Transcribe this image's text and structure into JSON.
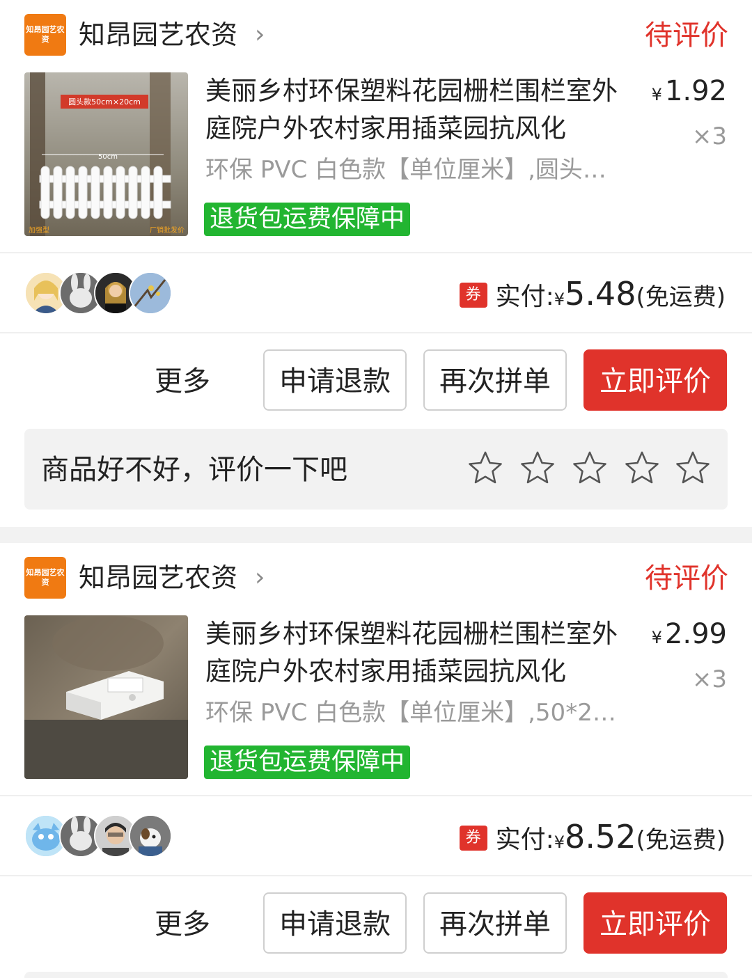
{
  "orders": [
    {
      "store": {
        "logo_text": "知昂园艺农资",
        "name": "知昂园艺农资",
        "chevron": "›"
      },
      "status": "待评价",
      "product": {
        "title": "美丽乡村环保塑料花园栅栏围栏室外庭院户外农村家用插菜园抗风化",
        "spec": "环保 PVC 白色款【单位厘米】,圆头…",
        "badge": "退货包运费保障中",
        "currency": "¥",
        "price": "1.92",
        "qty": "×3",
        "image_labels": {
          "top": "圆头款50cm×20cm",
          "width": "50cm",
          "bottom_left": "加强型",
          "bottom_right": "厂销批发价"
        }
      },
      "payment": {
        "coupon": "券",
        "label": "实付:",
        "currency": "¥",
        "amount": "5.48",
        "shipping": "(免运费)"
      },
      "actions": {
        "more": "更多",
        "refund": "申请退款",
        "reorder": "再次拼单",
        "review": "立即评价"
      },
      "review_prompt": "商品好不好，评价一下吧",
      "stars": 5
    },
    {
      "store": {
        "logo_text": "知昂园艺农资",
        "name": "知昂园艺农资",
        "chevron": "›"
      },
      "status": "待评价",
      "product": {
        "title": "美丽乡村环保塑料花园栅栏围栏室外庭院户外农村家用插菜园抗风化",
        "spec": "环保 PVC 白色款【单位厘米】,50*2…",
        "badge": "退货包运费保障中",
        "currency": "¥",
        "price": "2.99",
        "qty": "×3"
      },
      "payment": {
        "coupon": "券",
        "label": "实付:",
        "currency": "¥",
        "amount": "8.52",
        "shipping": "(免运费)"
      },
      "actions": {
        "more": "更多",
        "refund": "申请退款",
        "reorder": "再次拼单",
        "review": "立即评价"
      }
    }
  ],
  "colors": {
    "accent": "#e0332b",
    "badge_green": "#22b531",
    "logo_orange": "#f07a12",
    "muted": "#9a9a9a"
  },
  "icons": [
    "store-logo",
    "chevron-right-icon",
    "coupon-icon",
    "star-outline-icon",
    "avatar"
  ]
}
